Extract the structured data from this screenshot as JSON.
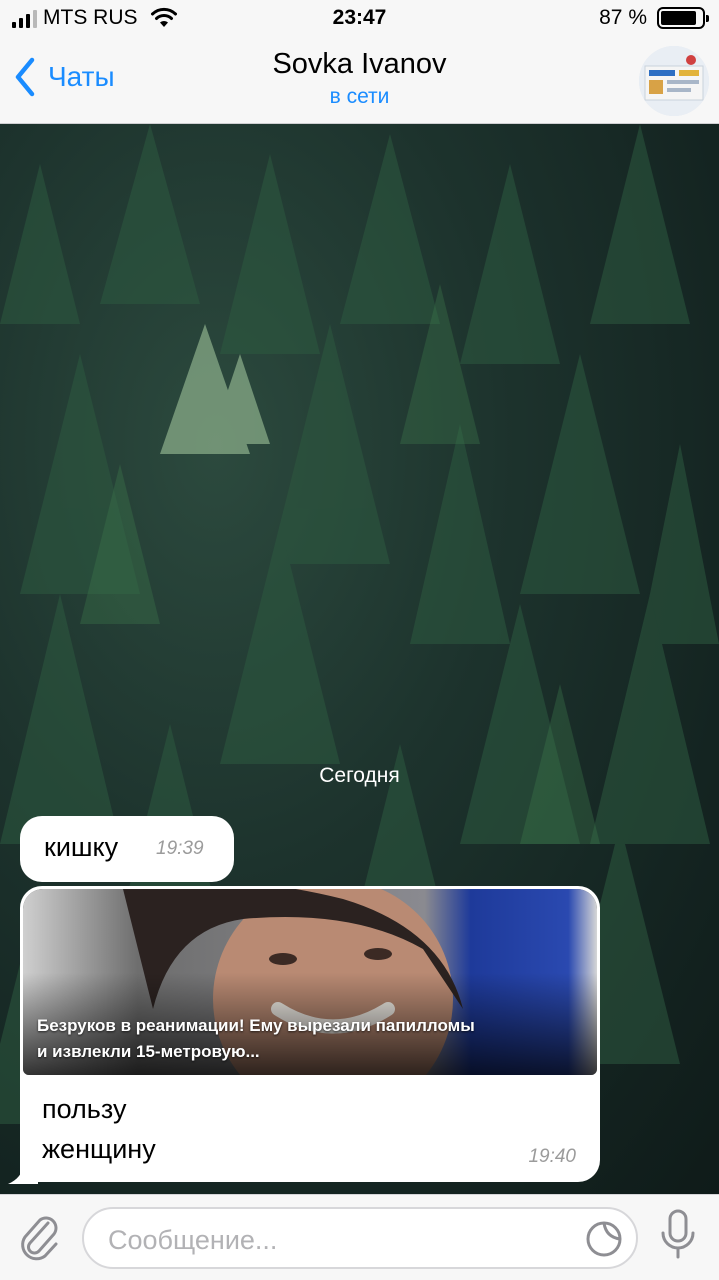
{
  "status_bar": {
    "carrier": "MTS RUS",
    "time": "23:47",
    "battery": "87 %",
    "battery_level": 0.87
  },
  "nav": {
    "back_label": "Чаты",
    "title": "Sovka Ivanov",
    "subtitle": "в сети"
  },
  "chat": {
    "date_separator": "Сегодня",
    "messages": [
      {
        "text": "кишку",
        "time": "19:39"
      },
      {
        "preview_caption_line1": "Безруков в реанимации! Ему вырезали папилломы",
        "preview_caption_line2": "и извлекли 15-метровую...",
        "line1": "пользу",
        "line2": "женщину",
        "time": "19:40"
      }
    ]
  },
  "input": {
    "placeholder": "Сообщение..."
  },
  "colors": {
    "accent": "#1a8cff",
    "bar_background": "#f7f7f7",
    "bubble": "#ffffff"
  },
  "icons": [
    "back-chevron-icon",
    "wifi-icon",
    "battery-icon",
    "attach-icon",
    "sticker-icon",
    "mic-icon"
  ]
}
